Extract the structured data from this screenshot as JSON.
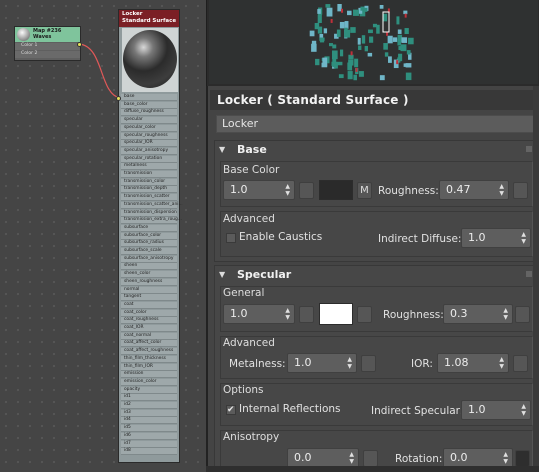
{
  "graph": {
    "waves_node": {
      "title_line1": "Map #236",
      "title_line2": "Waves",
      "ports": [
        "Color 1",
        "Color 2"
      ]
    },
    "material_node": {
      "title_line1": "Locker",
      "title_line2": "Standard Surface",
      "ports": [
        "base",
        "base_color",
        "diffuse_roughness",
        "specular",
        "specular_color",
        "specular_roughness",
        "specular_IOR",
        "specular_anisotropy",
        "specular_rotation",
        "metalness",
        "transmission",
        "transmission_color",
        "transmission_depth",
        "transmission_scatter",
        "transmission_scatter_ani...",
        "transmission_dispersion",
        "transmission_extra_roug...",
        "subsurface",
        "subsurface_color",
        "subsurface_radius",
        "subsurface_scale",
        "subsurface_anisotropy",
        "sheen",
        "sheen_color",
        "sheen_roughness",
        "normal",
        "tangent",
        "coat",
        "coat_color",
        "coat_roughness",
        "coat_IOR",
        "coat_normal",
        "coat_affect_color",
        "coat_affect_roughness",
        "thin_film_thickness",
        "thin_film_IOR",
        "emission",
        "emission_color",
        "opacity",
        "id1",
        "id2",
        "id3",
        "id4",
        "id5",
        "id6",
        "id7",
        "id8"
      ]
    }
  },
  "props": {
    "title": "Locker  ( Standard Surface )",
    "name_value": "Locker",
    "base": {
      "header": "Base",
      "color_group_label": "Base Color",
      "weight": "1.0",
      "map_letter": "M",
      "roughness_label": "Roughness:",
      "roughness": "0.47",
      "swatch_color": "#2a2a2a",
      "advanced_label": "Advanced",
      "caustics_label": "Enable Caustics",
      "caustics_checked": false,
      "indirect_diffuse_label": "Indirect Diffuse:",
      "indirect_diffuse": "1.0"
    },
    "specular": {
      "header": "Specular",
      "general_label": "General",
      "weight": "1.0",
      "swatch_color": "#ffffff",
      "roughness_label": "Roughness:",
      "roughness": "0.3",
      "advanced_label": "Advanced",
      "metalness_label": "Metalness:",
      "metalness": "1.0",
      "ior_label": "IOR:",
      "ior": "1.08",
      "options_label": "Options",
      "internal_reflections_label": "Internal Reflections",
      "internal_reflections_checked": true,
      "indirect_specular_label": "Indirect Specular:",
      "indirect_specular": "1.0",
      "anisotropy_label": "Anisotropy",
      "anisotropy": "0.0",
      "rotation_label": "Rotation:",
      "rotation": "0.0"
    }
  },
  "icons": {
    "dropdown": "triangle-down-icon",
    "spinner": "spinner-arrows-icon",
    "check": "checkmark-icon"
  }
}
